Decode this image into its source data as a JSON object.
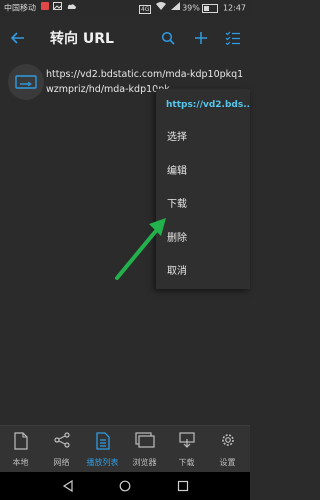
{
  "status_bar": {
    "carrier": "中国移动",
    "carrier_badge": "4G",
    "battery": "39%",
    "time": "12:47"
  },
  "toolbar": {
    "title": "转向 URL",
    "back_icon": "back-arrow-icon",
    "search_icon": "search-icon",
    "add_icon": "plus-icon",
    "select_icon": "checklist-icon"
  },
  "row": {
    "url": "https://vd2.bdstatic.com/mda-kdp10pkq1wzmpriz/hd/mda-kdp10pk",
    "thumb_icon": "link-icon"
  },
  "menu": {
    "header": "https://vd2.bds...",
    "items": [
      "选择",
      "编辑",
      "下载",
      "删除",
      "取消"
    ]
  },
  "annotation": {
    "arrow_color": "#22b14c"
  },
  "bottom_nav": {
    "items": [
      {
        "label": "本地",
        "icon": "file-icon"
      },
      {
        "label": "网络",
        "icon": "share-network-icon"
      },
      {
        "label": "播放列表",
        "icon": "playlist-icon",
        "active": true
      },
      {
        "label": "浏览器",
        "icon": "browser-icon"
      },
      {
        "label": "下载",
        "icon": "download-icon"
      },
      {
        "label": "设置",
        "icon": "gear-icon"
      }
    ]
  },
  "colors": {
    "accent": "#2f9be0",
    "menu_header": "#55c6ec",
    "background": "#2b2b2b"
  }
}
